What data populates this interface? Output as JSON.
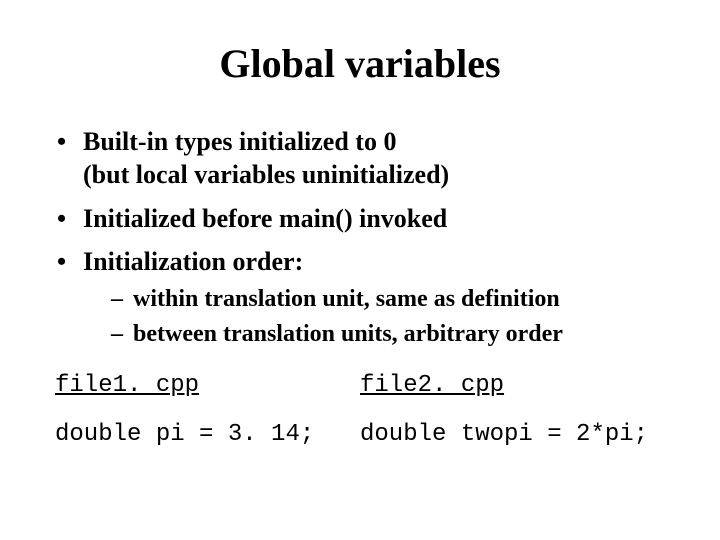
{
  "title": "Global variables",
  "bullets": {
    "b1_line1": "Built-in types initialized to 0",
    "b1_line2": "(but local variables uninitialized)",
    "b2": "Initialized before main() invoked",
    "b3": "Initialization order:",
    "s1": "within translation unit, same as definition",
    "s2": "between translation units, arbitrary order"
  },
  "code": {
    "file1_name": "file1. cpp",
    "file1_code": "double pi = 3. 14;",
    "file2_name": "file2. cpp",
    "file2_code": "double twopi = 2*pi;"
  }
}
